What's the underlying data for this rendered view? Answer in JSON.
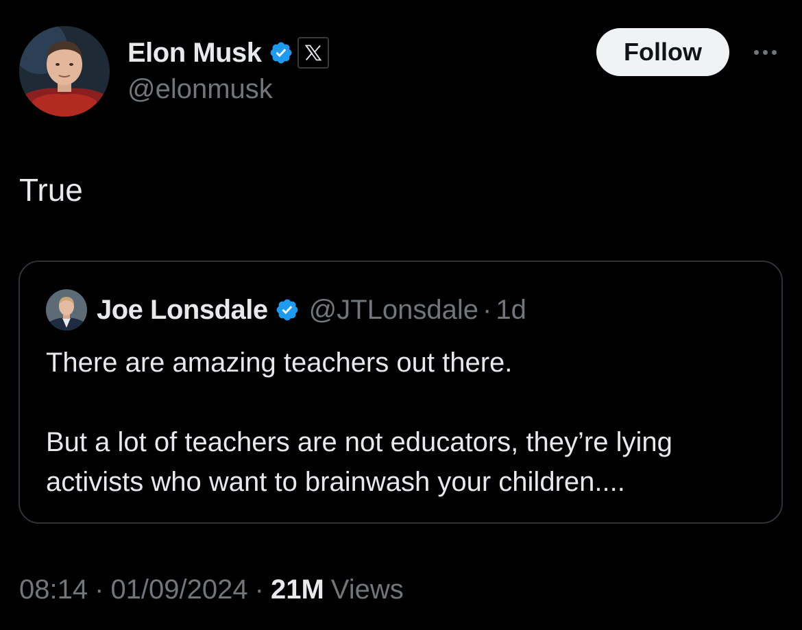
{
  "author": {
    "display_name": "Elon Musk",
    "handle": "@elonmusk",
    "verified_badge_icon": "verified-badge-icon",
    "affiliate_badge_icon": "x-logo-icon"
  },
  "actions": {
    "follow_label": "Follow",
    "more_icon": "more-dots-icon"
  },
  "tweet": {
    "text": "True"
  },
  "quote": {
    "display_name": "Joe Lonsdale",
    "handle": "@JTLonsdale",
    "separator": "·",
    "time": "1d",
    "paragraphs": [
      "There are amazing teachers out there.",
      "But a lot of teachers are not educators, they’re lying activists who want to brainwash your children...."
    ]
  },
  "meta": {
    "time": "08:14",
    "separator": "·",
    "date": "01/09/2024",
    "views_count": "21M",
    "views_label": "Views"
  },
  "colors": {
    "background": "#000000",
    "primary_text": "#e7e9ea",
    "secondary_text": "#71767b",
    "verified_blue": "#1d9bf0",
    "border": "#2f3336",
    "follow_bg": "#eff3f4"
  }
}
